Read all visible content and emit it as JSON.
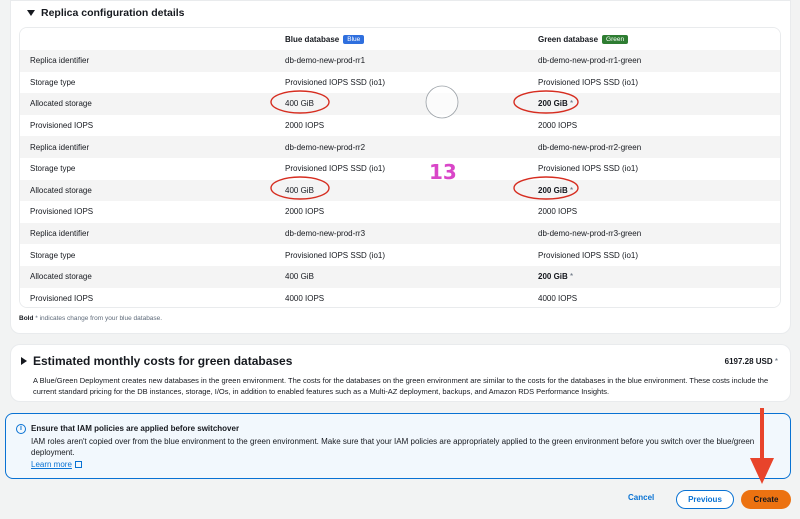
{
  "replica_section": {
    "title": "Replica configuration details",
    "headers": {
      "col1": "",
      "blue": "Blue database",
      "blue_badge": "Blue",
      "green": "Green database",
      "green_badge": "Green"
    },
    "rows": [
      {
        "label": "Replica identifier",
        "blue": "db-demo-new-prod-rr1",
        "green": "db-demo-new-prod-rr1-green",
        "changed": false
      },
      {
        "label": "Storage type",
        "blue": "Provisioned IOPS SSD (io1)",
        "green": "Provisioned IOPS SSD (io1)",
        "changed": false
      },
      {
        "label": "Allocated storage",
        "blue": "400 GiB",
        "green": "200 GiB",
        "changed": true
      },
      {
        "label": "Provisioned IOPS",
        "blue": "2000 IOPS",
        "green": "2000 IOPS",
        "changed": false
      },
      {
        "label": "Replica identifier",
        "blue": "db-demo-new-prod-rr2",
        "green": "db-demo-new-prod-rr2-green",
        "changed": false
      },
      {
        "label": "Storage type",
        "blue": "Provisioned IOPS SSD (io1)",
        "green": "Provisioned IOPS SSD (io1)",
        "changed": false
      },
      {
        "label": "Allocated storage",
        "blue": "400 GiB",
        "green": "200 GiB",
        "changed": true
      },
      {
        "label": "Provisioned IOPS",
        "blue": "2000 IOPS",
        "green": "2000 IOPS",
        "changed": false
      },
      {
        "label": "Replica identifier",
        "blue": "db-demo-new-prod-rr3",
        "green": "db-demo-new-prod-rr3-green",
        "changed": false
      },
      {
        "label": "Storage type",
        "blue": "Provisioned IOPS SSD (io1)",
        "green": "Provisioned IOPS SSD (io1)",
        "changed": false
      },
      {
        "label": "Allocated storage",
        "blue": "400 GiB",
        "green": "200 GiB",
        "changed": true
      },
      {
        "label": "Provisioned IOPS",
        "blue": "4000 IOPS",
        "green": "4000 IOPS",
        "changed": false
      }
    ],
    "footnote_bold": "Bold",
    "footnote_rest": " * indicates change from your blue database."
  },
  "cost_section": {
    "title": "Estimated monthly costs for green databases",
    "value": "6197.28 USD",
    "value_mark": " *",
    "description": "A Blue/Green Deployment creates new databases in the green environment. The costs for the databases on the green environment are similar to the costs for the databases in the blue environment. These costs include the current standard pricing for the DB instances, storage, I/Os, in addition to enabled features such as a Multi-AZ deployment, backups, and Amazon RDS Performance Insights."
  },
  "alert": {
    "icon": "info-icon",
    "title": "Ensure that IAM policies are applied before switchover",
    "body": "IAM roles aren't copied over from the blue environment to the green environment. Make sure that your IAM policies are appropriately applied to the green environment before you switch over the blue/green deployment.",
    "link": "Learn more"
  },
  "footer": {
    "cancel": "Cancel",
    "previous": "Previous",
    "create": "Create"
  },
  "annotation": {
    "step_number": "13",
    "accent_color": "#d946c8",
    "circle_color": "#d62d20",
    "arrow_color": "#e8442b"
  },
  "colors": {
    "link": "#0972d3",
    "primary_button": "#ec7211",
    "blue_badge": "#2f6fde",
    "green_badge": "#2e7d32"
  }
}
